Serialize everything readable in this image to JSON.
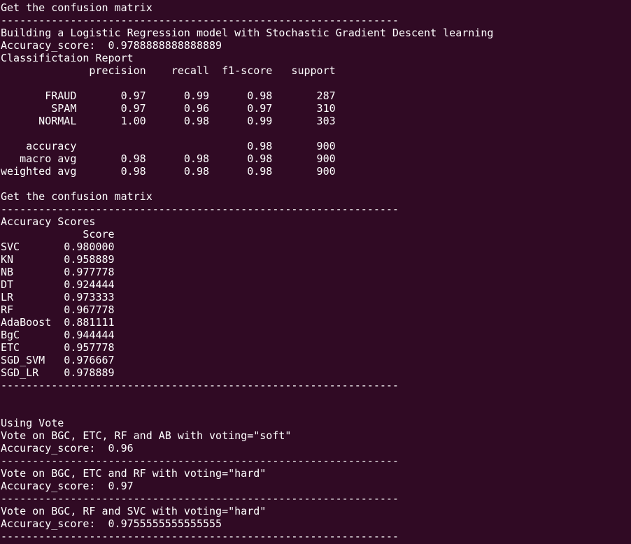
{
  "colors": {
    "background": "#300a24",
    "foreground": "#ffffff"
  },
  "terminal": {
    "lines": [
      "Get the confusion matrix",
      "----------------------------------------------------------------",
      "Building a Logistic Regression model with Stochastic Gradient Descent learning",
      "Accuracy_score:  0.9788888888888889",
      "Classifictaion Report",
      "              precision    recall  f1-score   support",
      "",
      "       FRAUD       0.97      0.99      0.98       287",
      "        SPAM       0.97      0.96      0.97       310",
      "      NORMAL       1.00      0.98      0.99       303",
      "",
      "    accuracy                           0.98       900",
      "   macro avg       0.98      0.98      0.98       900",
      "weighted avg       0.98      0.98      0.98       900",
      "",
      "Get the confusion matrix",
      "----------------------------------------------------------------",
      "Accuracy Scores",
      "             Score",
      "SVC       0.980000",
      "KN        0.958889",
      "NB        0.977778",
      "DT        0.924444",
      "LR        0.973333",
      "RF        0.967778",
      "AdaBoost  0.881111",
      "BgC       0.944444",
      "ETC       0.957778",
      "SGD_SVM   0.976667",
      "SGD_LR    0.978889",
      "----------------------------------------------------------------",
      "",
      "",
      "Using Vote",
      "Vote on BGC, ETC, RF and AB with voting=\"soft\"",
      "Accuracy_score:  0.96",
      "----------------------------------------------------------------",
      "Vote on BGC, ETC and RF with voting=\"hard\"",
      "Accuracy_score:  0.97",
      "----------------------------------------------------------------",
      "Vote on BGC, RF and SVC with voting=\"hard\"",
      "Accuracy_score:  0.9755555555555555",
      "----------------------------------------------------------------"
    ]
  }
}
